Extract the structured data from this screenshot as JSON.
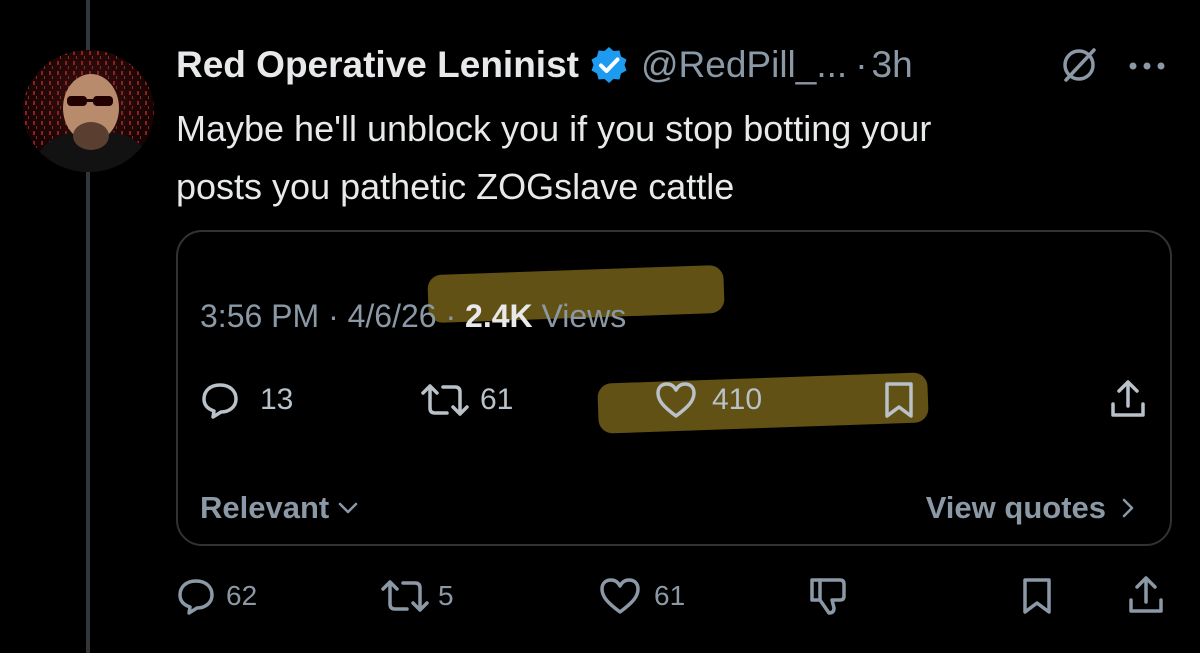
{
  "post": {
    "display_name": "Red Operative Leninist",
    "handle": "@RedPill_...",
    "separator": "·",
    "age": "3h",
    "text_line1": "Maybe he'll unblock you if you stop botting your",
    "text_line2": "posts you pathetic ZOGslave cattle"
  },
  "quote": {
    "time": "3:56 PM",
    "dot1": " · ",
    "date": "4/6/26",
    "dot2": " · ",
    "views": "2.4K",
    "views_label": " Views",
    "replies": "13",
    "reposts": "61",
    "likes": "410",
    "sort_label": "Relevant",
    "view_quotes_label": "View quotes"
  },
  "actions": {
    "replies": "62",
    "reposts": "5",
    "likes": "61"
  },
  "colors": {
    "background": "#000000",
    "text": "#e7e9ea",
    "muted": "#8b98a5",
    "verified": "#1d9bf0",
    "highlight": "#6b5a16"
  },
  "icons": [
    "mute-icon",
    "more-icon",
    "verified-badge-icon",
    "reply-icon",
    "repost-icon",
    "like-icon",
    "bookmark-icon",
    "share-icon",
    "dislike-icon",
    "chevron-down-icon",
    "chevron-right-icon"
  ]
}
